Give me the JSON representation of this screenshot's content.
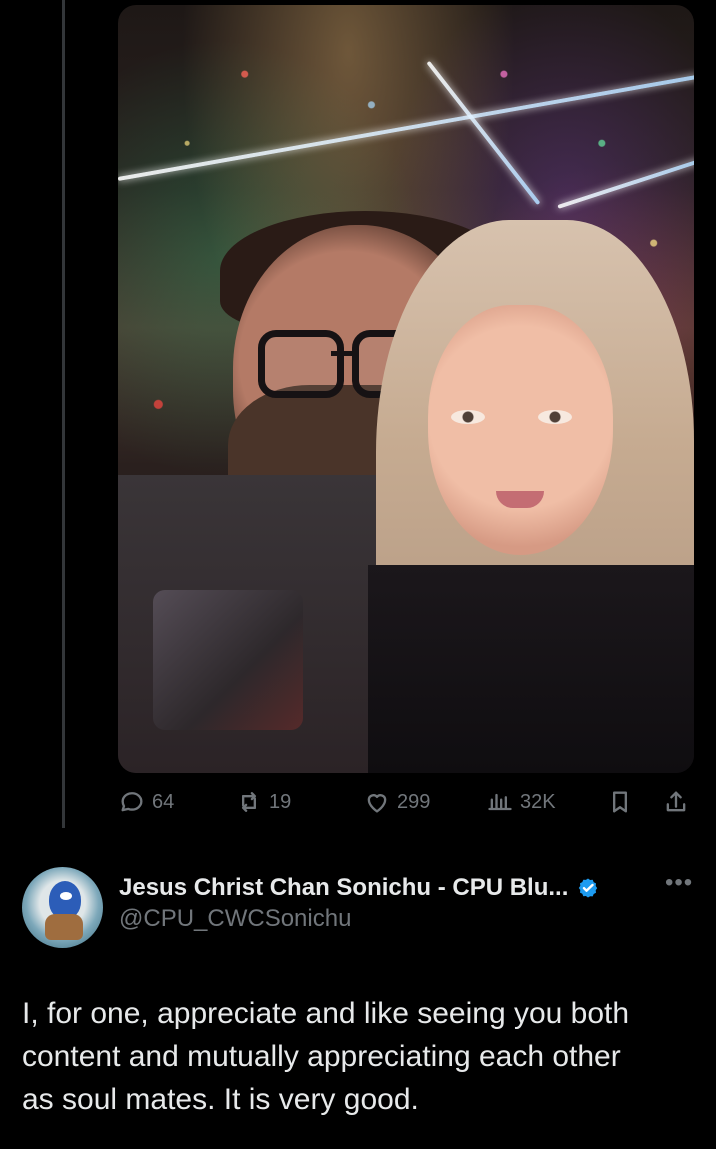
{
  "tweet_actions": {
    "replies": "64",
    "reposts": "19",
    "likes": "299",
    "views": "32K"
  },
  "reply": {
    "display_name": "Jesus Christ Chan Sonichu - CPU Blu...",
    "handle": "@CPU_CWCSonichu",
    "text_lines": [
      "I, for one, appreciate and like seeing you both",
      "content and mutually appreciating each other",
      "as soul mates.  It is very good."
    ]
  },
  "icons": {
    "reply": "reply-icon",
    "repost": "repost-icon",
    "like": "heart-icon",
    "views": "views-icon",
    "bookmark": "bookmark-icon",
    "share": "share-icon",
    "verified": "verified-icon",
    "more": "more-icon"
  },
  "colors": {
    "background": "#000000",
    "primary_text": "#e7e9ea",
    "secondary_text": "#71767b",
    "verified": "#1d9bf0"
  }
}
